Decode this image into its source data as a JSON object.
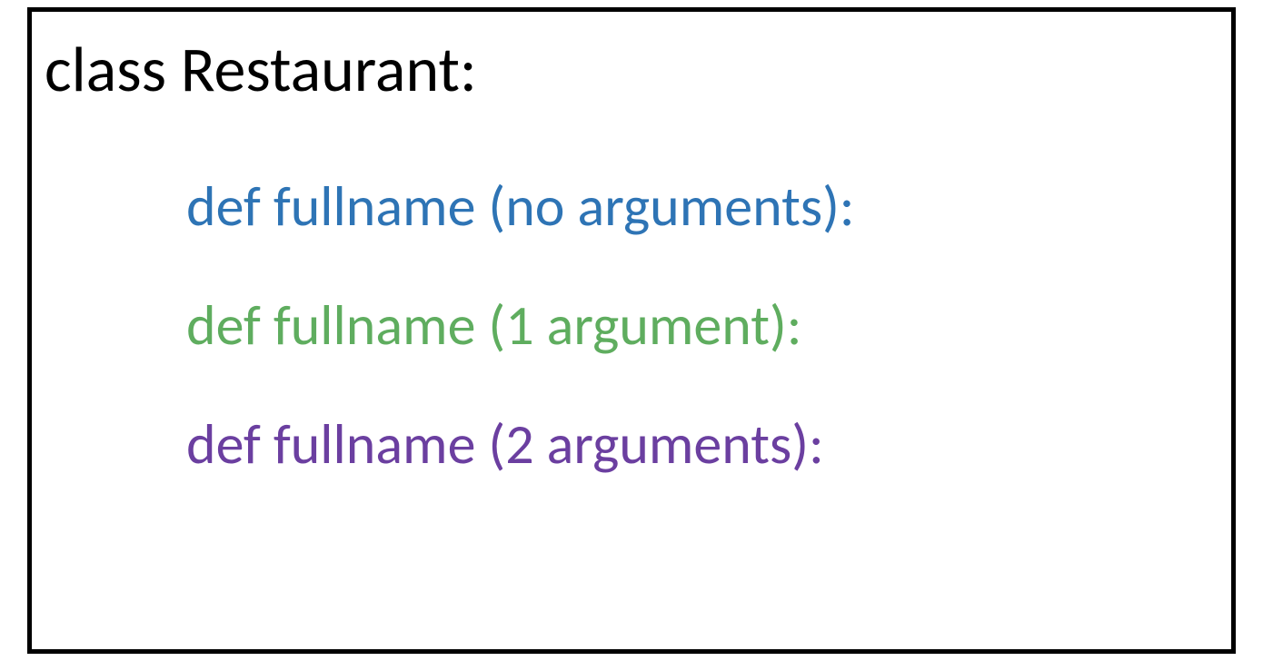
{
  "classDeclaration": "class Restaurant:",
  "methods": [
    {
      "text": "def fullname (no arguments):",
      "colorClass": "blue"
    },
    {
      "text": "def fullname (1 argument):",
      "colorClass": "green"
    },
    {
      "text": "def fullname (2 arguments):",
      "colorClass": "purple"
    }
  ]
}
